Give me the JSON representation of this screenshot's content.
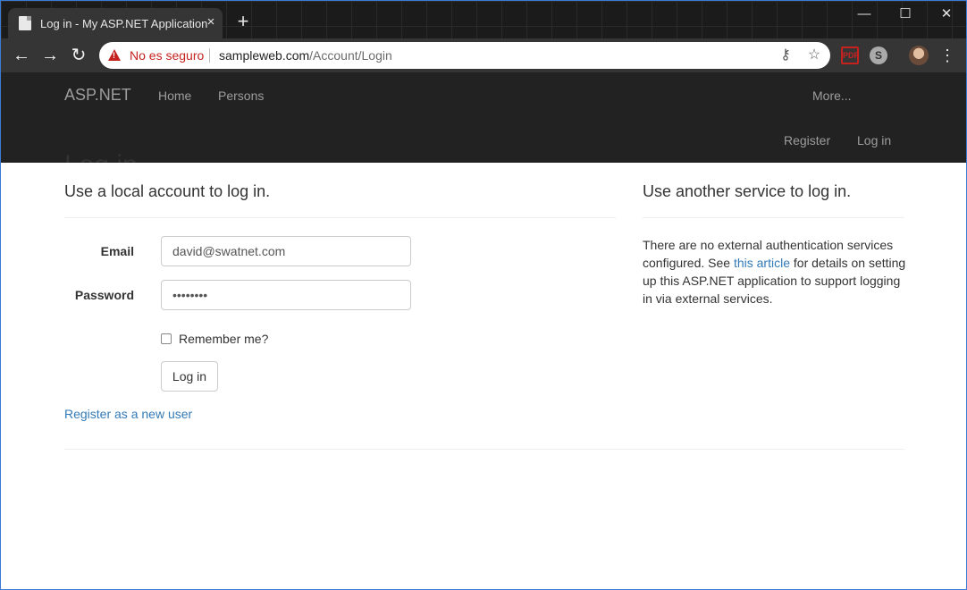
{
  "browser": {
    "tab_title": "Log in - My ASP.NET Application",
    "tab_close": "×",
    "new_tab": "+",
    "minimize": "—",
    "maximize": "☐",
    "close": "✕",
    "back": "←",
    "forward": "→",
    "reload": "↻",
    "not_secure": "No es seguro",
    "url_host": "sampleweb.com",
    "url_path": "/Account/Login",
    "key_icon": "⚷",
    "star_icon": "☆",
    "pdf_label": "PDF",
    "skype_label": "S",
    "menu": "⋮"
  },
  "navbar": {
    "brand": "ASP.NET",
    "links": [
      "Home",
      "Persons"
    ],
    "more": "More...",
    "register": "Register",
    "login": "Log in"
  },
  "page": {
    "heading_cutoff": "Log in.",
    "local_heading": "Use a local account to log in.",
    "email_label": "Email",
    "email_value": "david@swatnet.com",
    "password_label": "Password",
    "password_value": "••••••••",
    "remember_label": "Remember me?",
    "login_button": "Log in",
    "register_link": "Register as a new user",
    "external_heading": "Use another service to log in.",
    "external_text_1": "There are no external authentication services configured. See ",
    "external_link": "this article",
    "external_text_2": " for details on setting up this ASP.NET application to support logging in via external services."
  },
  "colors": {
    "navbar_bg": "#222222",
    "link": "#337ab7",
    "warning": "#c5221f"
  }
}
